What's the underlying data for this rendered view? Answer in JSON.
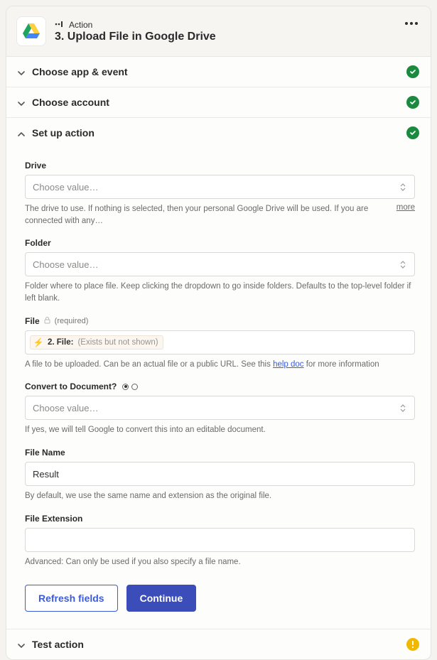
{
  "header": {
    "eyebrow": "Action",
    "title": "3. Upload File in Google Drive"
  },
  "sections": {
    "choose_app": "Choose app & event",
    "choose_account": "Choose account",
    "setup": "Set up action",
    "test": "Test action"
  },
  "fields": {
    "drive": {
      "label": "Drive",
      "placeholder": "Choose value…",
      "help": "The drive to use. If nothing is selected, then your personal Google Drive will be used. If you are connected with any…",
      "more": "more"
    },
    "folder": {
      "label": "Folder",
      "placeholder": "Choose value…",
      "help": "Folder where to place file. Keep clicking the dropdown to go inside folders. Defaults to the top-level folder if left blank."
    },
    "file": {
      "label": "File",
      "required": "(required)",
      "pill_prefix": "2. File:",
      "pill_suffix": "(Exists but not shown)",
      "help_before": "A file to be uploaded. Can be an actual file or a public URL. See this ",
      "help_link": "help doc",
      "help_after": " for more information"
    },
    "convert": {
      "label": "Convert to Document?",
      "placeholder": "Choose value…",
      "help": "If yes, we will tell Google to convert this into an editable document."
    },
    "filename": {
      "label": "File Name",
      "value": "Result",
      "help": "By default, we use the same name and extension as the original file."
    },
    "fileext": {
      "label": "File Extension",
      "value": "",
      "help": "Advanced: Can only be used if you also specify a file name."
    }
  },
  "buttons": {
    "refresh": "Refresh fields",
    "continue": "Continue"
  }
}
